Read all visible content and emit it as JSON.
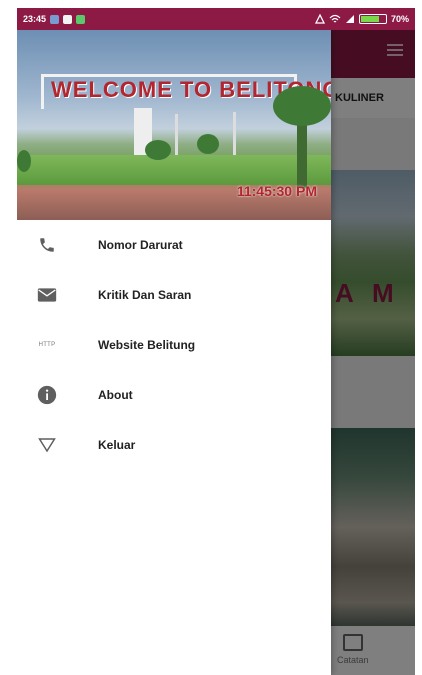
{
  "status_bar": {
    "time": "23:45",
    "battery": "70%"
  },
  "background_app": {
    "tab_label": "KULINER",
    "card_text": "A M",
    "bottom_nav_label": "Catatan"
  },
  "drawer": {
    "header": {
      "sign_text": "WELCOME TO BELITONG",
      "clock": "11:45:30 PM"
    },
    "menu_items": [
      {
        "label": "Nomor Darurat",
        "icon": "phone-icon"
      },
      {
        "label": "Kritik Dan Saran",
        "icon": "mail-icon"
      },
      {
        "label": "Website Belitung",
        "icon": "http-icon",
        "icon_text": "HTTP"
      },
      {
        "label": "About",
        "icon": "info-icon"
      },
      {
        "label": "Keluar",
        "icon": "exit-triangle-icon"
      }
    ]
  },
  "colors": {
    "primary": "#8c1a45",
    "clock_red": "#b1262f"
  }
}
